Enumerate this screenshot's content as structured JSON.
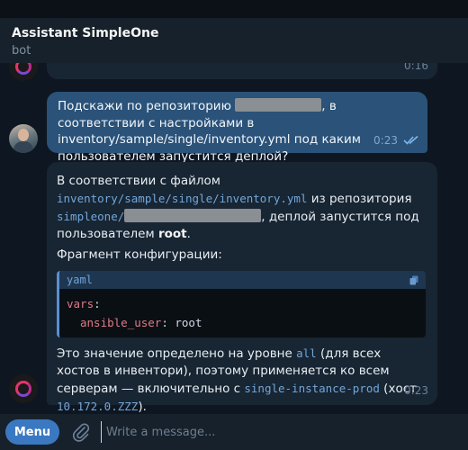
{
  "header": {
    "title": "Assistant SimpleOne",
    "subtitle": "bot"
  },
  "messages": {
    "previous": {
      "time": "0:16"
    },
    "user": {
      "text_1": "Подскажи по репозиторию",
      "text_2": ", в соответствии с настройками в inventory/sample/single/inventory.yml под каким пользователем запустится деплой?",
      "time": "0:23",
      "status": "read"
    },
    "bot": {
      "line1_prefix": "В соответствии с файлом",
      "file_path": "inventory/sample/single/inventory.yml",
      "line1_suffix": " из репозитория",
      "repo_prefix": "simpleone/",
      "line2_suffix": ", деплой запустится под пользователем",
      "user_value": "root",
      "period": ".",
      "fragment_label": "Фрагмент конфигурации:",
      "code": {
        "lang": "yaml",
        "line1_key": "vars",
        "line1_colon": ":",
        "line2_key": "ansible_user",
        "line2_colon": ":",
        "line2_value": "root"
      },
      "p3_a": "Это значение определено на уровне ",
      "p3_all": "all",
      "p3_b": " (для всех хостов в инвентори), поэтому применяется ко всем серверам — включительно с ",
      "p3_host": "single-instance-prod",
      "p3_c": " (хост ",
      "p3_ip": "10.172.0.ZZZ",
      "p3_d": ").",
      "time": "0:23"
    }
  },
  "composer": {
    "menu_label": "Menu",
    "placeholder": "Write a message..."
  },
  "colors": {
    "accent": "#3a79c2",
    "outgoing_bubble": "#2b5278",
    "incoming_bubble": "#182533",
    "background": "#0e1621"
  }
}
